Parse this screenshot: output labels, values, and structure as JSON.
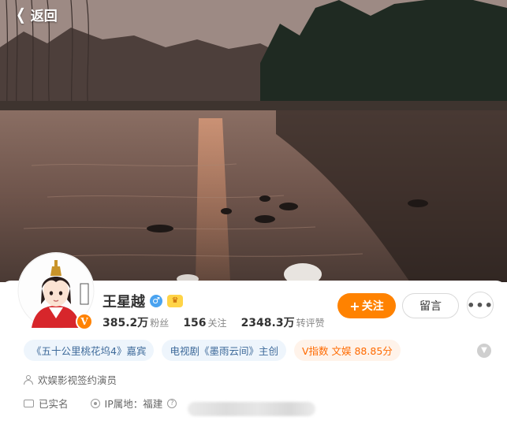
{
  "header": {
    "back_label": "返回"
  },
  "profile": {
    "name": "王星越",
    "verified_badge": "V",
    "gender_icon": "male-icon",
    "stats": [
      {
        "value": "385.2万",
        "label": "粉丝"
      },
      {
        "value": "156",
        "label": "关注"
      },
      {
        "value": "2348.3万",
        "label": "转评赞"
      }
    ],
    "actions": {
      "follow_label": "关注",
      "follow_prefix": "+",
      "message_label": "留言",
      "more_label": "•••"
    }
  },
  "tags": [
    "《五十公里桃花坞4》嘉宾",
    "电视剧《墨雨云间》主创",
    "V指数 文娱 88.85分"
  ],
  "info": {
    "description": "欢娱影视签约演员",
    "real_name": "已实名",
    "ip_location": "IP属地：福建"
  },
  "colors": {
    "accent": "#ff8200",
    "tag_bg": "#eef5fc",
    "tag_text": "#3e6a9a"
  }
}
